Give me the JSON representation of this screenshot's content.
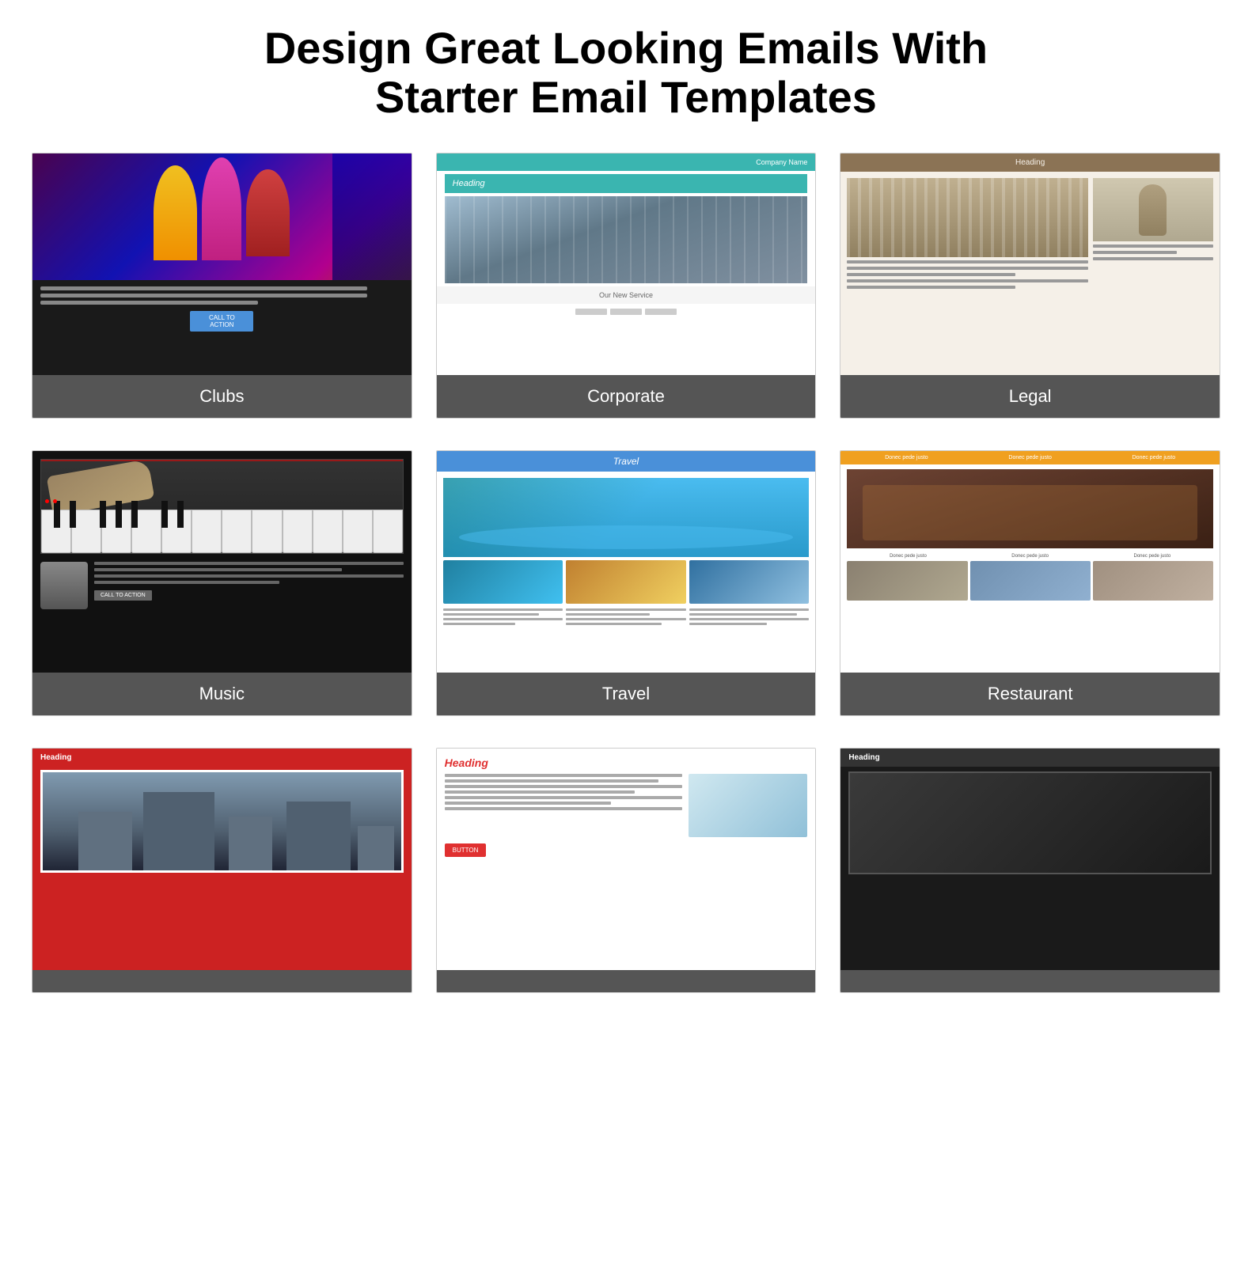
{
  "page": {
    "title_line1": "Design Great Looking Emails With",
    "title_line2": "Starter Email Templates"
  },
  "templates": [
    {
      "id": "clubs",
      "label": "Clubs",
      "previewType": "clubs"
    },
    {
      "id": "corporate",
      "label": "Corporate",
      "previewType": "corporate"
    },
    {
      "id": "legal",
      "label": "Legal",
      "previewType": "legal"
    },
    {
      "id": "music",
      "label": "Music",
      "previewType": "music"
    },
    {
      "id": "travel",
      "label": "Travel",
      "previewType": "travel"
    },
    {
      "id": "restaurant",
      "label": "Restaurant",
      "previewType": "restaurant"
    },
    {
      "id": "partial1",
      "label": "",
      "previewType": "partial-red"
    },
    {
      "id": "partial2",
      "label": "",
      "previewType": "partial-white"
    },
    {
      "id": "partial3",
      "label": "",
      "previewType": "partial-dark"
    }
  ],
  "corporate_preview": {
    "company_name": "Company Name",
    "heading": "Heading",
    "service_label": "Our New Service"
  },
  "legal_preview": {
    "heading": "Heading"
  },
  "travel_preview": {
    "header": "Travel"
  },
  "restaurant_preview": {
    "nav1": "Donec pede justo",
    "nav2": "Donec pede justo",
    "nav3": "Donec pede justo"
  },
  "partial_red": {
    "heading": "Heading"
  },
  "partial_white": {
    "heading": "Heading"
  },
  "partial_dark": {
    "heading": "Heading"
  },
  "clubs_preview": {
    "cta": "CALL TO ACTION"
  },
  "music_preview": {
    "cta": "CALL TO ACTION"
  }
}
